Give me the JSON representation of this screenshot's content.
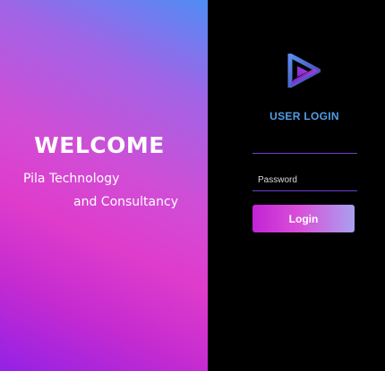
{
  "welcome": {
    "title": "WELCOME",
    "tagline_line1": "Pila Technology",
    "tagline_line2": "and Consultancy"
  },
  "login": {
    "heading": "USER LOGIN",
    "username_value": "",
    "password_placeholder": "Password",
    "button_label": "Login"
  },
  "icons": {
    "logo": "play-triangle-logo-icon"
  },
  "colors": {
    "heading": "#4f9ee8",
    "input_underline": "#6f3fd0",
    "background_right": "#000000",
    "gradient_top": "#4f8df5",
    "gradient_mid": "#df3ccb",
    "gradient_bottom": "#9421e6"
  }
}
